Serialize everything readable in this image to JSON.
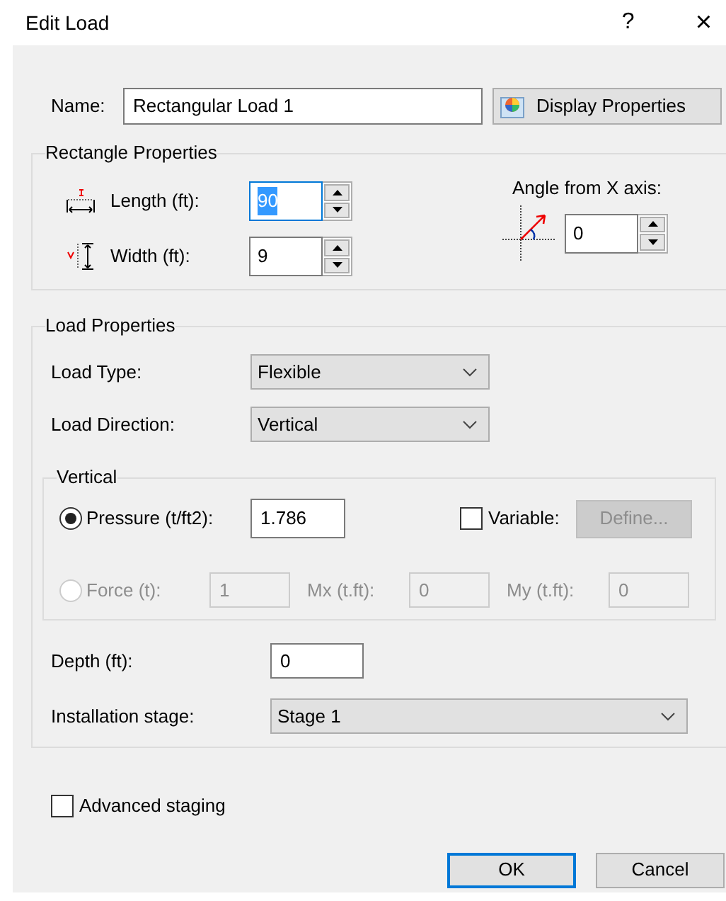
{
  "window": {
    "title": "Edit Load",
    "help": "?",
    "close": "×"
  },
  "name": {
    "label": "Name:",
    "value": "Rectangular Load 1"
  },
  "display_properties_button": {
    "label": "Display Properties"
  },
  "rectangle_properties": {
    "title": "Rectangle Properties",
    "length": {
      "label": "Length (ft):",
      "value": "90",
      "highlighted": true
    },
    "width": {
      "label": "Width (ft):",
      "value": "9",
      "highlighted": false
    },
    "angle": {
      "label": "Angle from X axis:",
      "value": "0",
      "highlighted": false
    }
  },
  "load_properties": {
    "title": "Load Properties",
    "load_type": {
      "label": "Load Type:",
      "value": "Flexible"
    },
    "load_direction": {
      "label": "Load Direction:",
      "value": "Vertical"
    },
    "vertical": {
      "title": "Vertical",
      "pressure": {
        "label": "Pressure (t/ft2):",
        "value": "1.786",
        "selected": true,
        "disabled": false
      },
      "variable": {
        "label": "Variable:",
        "checked": false
      },
      "define_button": {
        "label": "Define...",
        "disabled": true
      },
      "force": {
        "label": "Force (t):",
        "value": "1",
        "selected": false,
        "disabled": true
      },
      "moments": [
        {
          "label": "Mx (t.ft):",
          "value": "0",
          "disabled": true
        },
        {
          "label": "My (t.ft):",
          "value": "0",
          "disabled": true
        }
      ]
    },
    "depth": {
      "label": "Depth (ft):",
      "value": "0"
    },
    "installation_stage": {
      "label": "Installation stage:",
      "value": "Stage 1"
    }
  },
  "advanced_staging": {
    "label": "Advanced staging",
    "checked": false
  },
  "buttons": [
    {
      "label": "OK",
      "default": true
    },
    {
      "label": "Cancel",
      "default": false
    }
  ]
}
